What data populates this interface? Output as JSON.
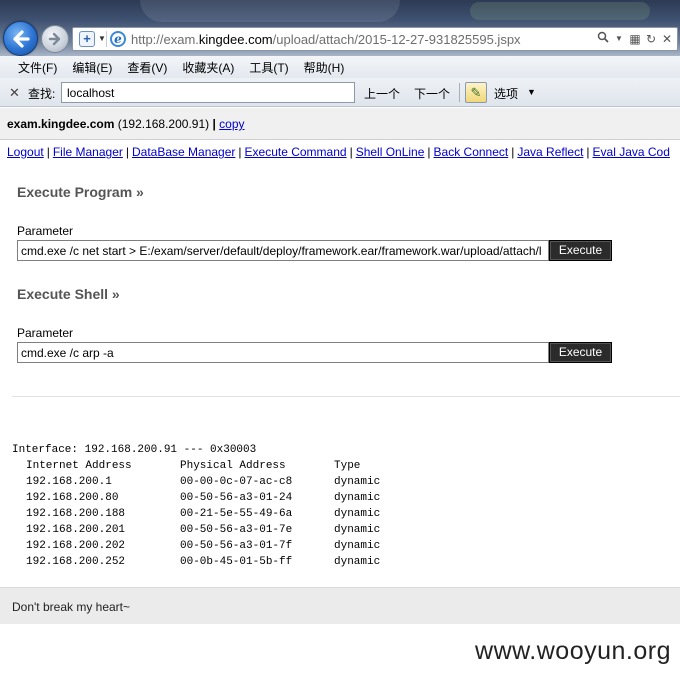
{
  "browser": {
    "url_prefix": "http://exam.",
    "url_domain": "kingdee.com",
    "url_path": "/upload/attach/2015-12-27-931825595.jspx",
    "menu": [
      "文件(F)",
      "编辑(E)",
      "查看(V)",
      "收藏夹(A)",
      "工具(T)",
      "帮助(H)"
    ],
    "find": {
      "label": "查找:",
      "value": "localhost",
      "prev": "上一个",
      "next": "下一个",
      "options": "选项"
    }
  },
  "header": {
    "host": "exam.kingdee.com",
    "ip": " (192.168.200.91) ",
    "pipe": "|",
    "copy": "copy"
  },
  "nav_links": [
    "Logout",
    "File Manager",
    "DataBase Manager",
    "Execute Command",
    "Shell OnLine",
    "Back Connect",
    "Java Reflect",
    "Eval Java Cod"
  ],
  "execute_program": {
    "title": "Execute Program »",
    "param_label": "Parameter",
    "command": "cmd.exe /c net start > E:/exam/server/default/deploy/framework.ear/framework.war/upload/attach/l",
    "button": "Execute"
  },
  "execute_shell": {
    "title": "Execute Shell »",
    "param_label": "Parameter",
    "command": "cmd.exe /c arp -a",
    "button": "Execute"
  },
  "output": {
    "interface_line": "Interface: 192.168.200.91 --- 0x30003",
    "headers": [
      "Internet Address",
      "Physical Address",
      "Type"
    ],
    "rows": [
      [
        "192.168.200.1",
        "00-00-0c-07-ac-c8",
        "dynamic"
      ],
      [
        "192.168.200.80",
        "00-50-56-a3-01-24",
        "dynamic"
      ],
      [
        "192.168.200.188",
        "00-21-5e-55-49-6a",
        "dynamic"
      ],
      [
        "192.168.200.201",
        "00-50-56-a3-01-7e",
        "dynamic"
      ],
      [
        "192.168.200.202",
        "00-50-56-a3-01-7f",
        "dynamic"
      ],
      [
        "192.168.200.252",
        "00-0b-45-01-5b-ff",
        "dynamic"
      ]
    ]
  },
  "footer": {
    "text": "Don't break my heart~"
  },
  "watermark": "www.wooyun.org",
  "colors": {
    "link": "#0000cc",
    "button_bg": "#2b2b2b",
    "section_title": "#555555"
  }
}
